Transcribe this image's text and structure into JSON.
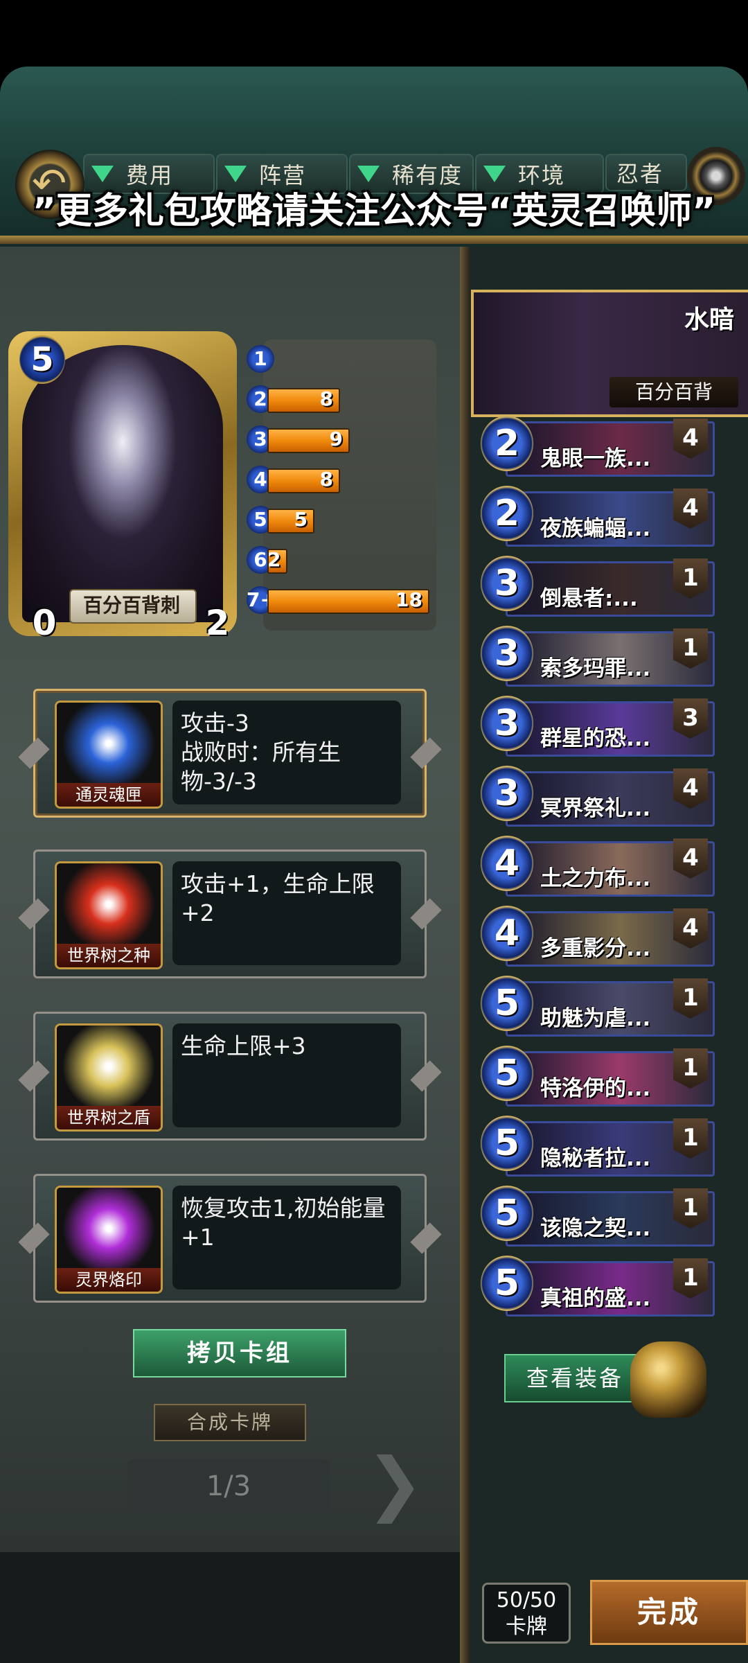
{
  "banner": "”更多礼包攻略请关注公众号“英灵召唤师”",
  "filters": [
    {
      "label": "费用"
    },
    {
      "label": "阵营"
    },
    {
      "label": "稀有度"
    },
    {
      "label": "环境"
    },
    {
      "label": "忍者"
    }
  ],
  "hero": {
    "name": "百分百背刺",
    "cost": "5",
    "attack": "0",
    "health": "2"
  },
  "mana_curve": [
    {
      "cost": "1",
      "count": "",
      "fill": 0
    },
    {
      "cost": "2",
      "count": "8",
      "fill": 0.44
    },
    {
      "cost": "3",
      "count": "9",
      "fill": 0.5
    },
    {
      "cost": "4",
      "count": "8",
      "fill": 0.44
    },
    {
      "cost": "5",
      "count": "5",
      "fill": 0.28
    },
    {
      "cost": "6",
      "count": "2",
      "fill": 0.11
    },
    {
      "cost": "7+",
      "count": "18",
      "fill": 1.0
    }
  ],
  "equipment": [
    {
      "name": "通灵魂匣",
      "desc": "攻击-3\n战败时：所有生物-3/-3",
      "color": "#2b63d8"
    },
    {
      "name": "世界树之种",
      "desc": "攻击+1，生命上限+2",
      "color": "#d8301c"
    },
    {
      "name": "世界树之盾",
      "desc": "生命上限+3",
      "color": "#d8c25a"
    },
    {
      "name": "灵界烙印",
      "desc": "恢复攻击1,初始能量+1",
      "color": "#b02ed8"
    }
  ],
  "controls": {
    "copy_deck": "拷贝卡组",
    "synth": "合成卡牌",
    "page": "1/3",
    "view_equip": "查看装备",
    "deck_count_line1": "50/50",
    "deck_count_line2": "卡牌",
    "done": "完成"
  },
  "deck_hero": {
    "name": "水暗",
    "sub": "百分百背"
  },
  "deck_list": [
    {
      "cost": "2",
      "name": "鬼眼一族...",
      "count": "4",
      "color": "#6b2a48"
    },
    {
      "cost": "2",
      "name": "夜族蝙蝠...",
      "count": "4",
      "color": "#3a4a8a"
    },
    {
      "cost": "3",
      "name": "倒悬者:...",
      "count": "1",
      "color": "#3a2a2a"
    },
    {
      "cost": "3",
      "name": "索多玛罪...",
      "count": "1",
      "color": "#7a7070"
    },
    {
      "cost": "3",
      "name": "群星的恐...",
      "count": "3",
      "color": "#5a3a9a"
    },
    {
      "cost": "3",
      "name": "冥界祭礼...",
      "count": "4",
      "color": "#3a3a5a"
    },
    {
      "cost": "4",
      "name": "土之力布...",
      "count": "4",
      "color": "#8a6a5a"
    },
    {
      "cost": "4",
      "name": "多重影分...",
      "count": "4",
      "color": "#7a6a4a"
    },
    {
      "cost": "5",
      "name": "助魅为虐...",
      "count": "1",
      "color": "#4a4a6a"
    },
    {
      "cost": "5",
      "name": "特洛伊的...",
      "count": "1",
      "color": "#9a3a6a"
    },
    {
      "cost": "5",
      "name": "隐秘者拉...",
      "count": "1",
      "color": "#3a3a7a"
    },
    {
      "cost": "5",
      "name": "该隐之契...",
      "count": "1",
      "color": "#2a3a5a"
    },
    {
      "cost": "5",
      "name": "真祖的盛...",
      "count": "1",
      "color": "#7a2a8a"
    }
  ]
}
